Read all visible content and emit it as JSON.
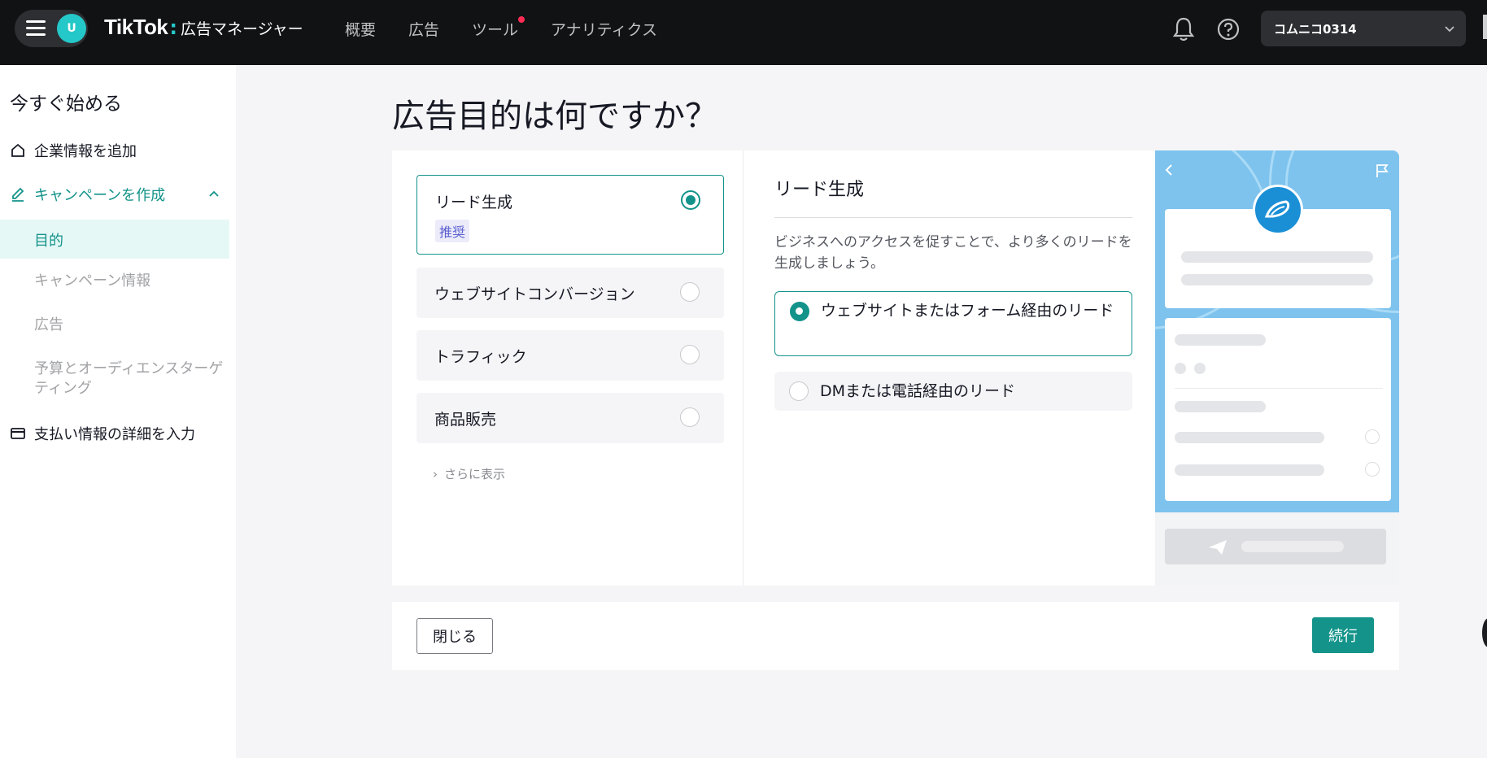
{
  "header": {
    "avatar_initial": "U",
    "brand_logo": "TikTok",
    "brand_separator": ":",
    "brand_name": "広告マネージャー",
    "nav": [
      {
        "label": "概要"
      },
      {
        "label": "広告"
      },
      {
        "label": "ツール",
        "has_notification": true
      },
      {
        "label": "アナリティクス"
      }
    ],
    "account_name": "コムニコ0314",
    "icons": [
      "menu-icon",
      "bell-icon",
      "help-icon",
      "chevron-down-icon"
    ]
  },
  "sidebar": {
    "title": "今すぐ始める",
    "company_info": "企業情報を追加",
    "create_campaign": "キャンペーンを作成",
    "steps": {
      "objective": "目的",
      "campaign_info": "キャンペーン情報",
      "ad": "広告",
      "budget_targeting": "予算とオーディエンスターゲティング"
    },
    "payment": "支払い情報の詳細を入力"
  },
  "main": {
    "title": "広告目的は何ですか？",
    "objectives": [
      {
        "label": "リード生成",
        "badge": "推奨",
        "selected": true
      },
      {
        "label": "ウェブサイトコンバージョン",
        "selected": false
      },
      {
        "label": "トラフィック",
        "selected": false
      },
      {
        "label": "商品販売",
        "selected": false
      }
    ],
    "show_more": "さらに表示",
    "detail": {
      "title": "リード生成",
      "description": "ビジネスへのアクセスを促すことで、より多くのリードを生成しましょう。",
      "options": [
        {
          "label": "ウェブサイトまたはフォーム経由のリード",
          "selected": true
        },
        {
          "label": "DMまたは電話経由のリード",
          "selected": false
        }
      ]
    }
  },
  "footer": {
    "close_label": "閉じる",
    "continue_label": "続行"
  },
  "colors": {
    "accent": "#13938a",
    "header_bg": "#111214",
    "badge_text": "#5b5fcf",
    "notification_dot": "#fe2c55"
  }
}
